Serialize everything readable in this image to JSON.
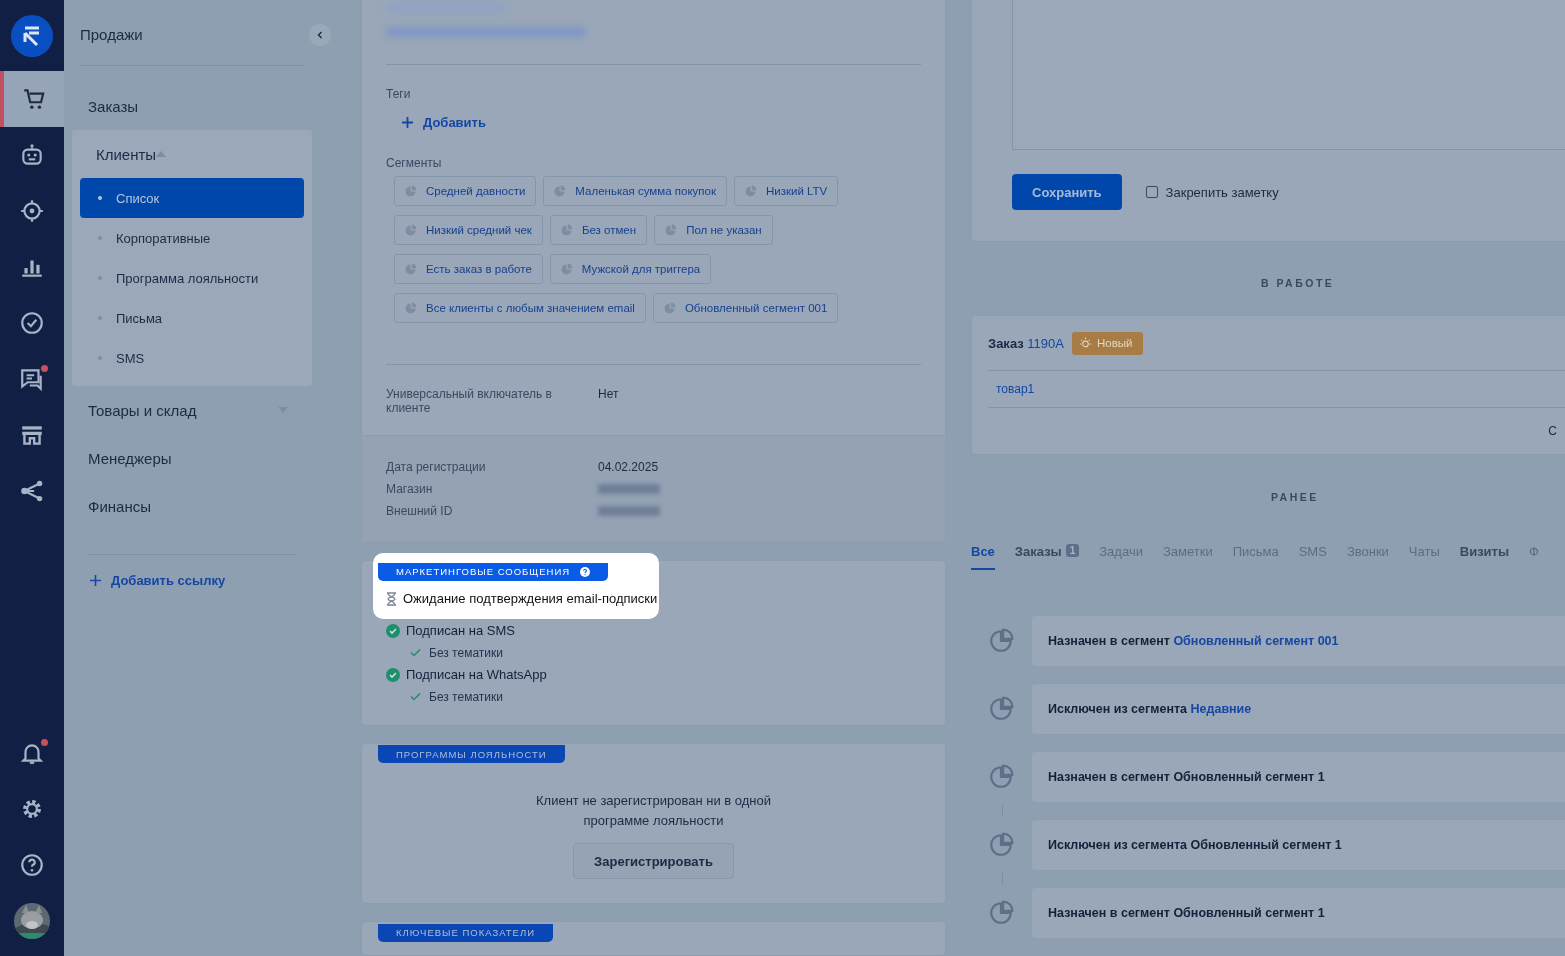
{
  "rail": {
    "items": [
      {
        "kind": "logo",
        "selected": false,
        "dot": false
      },
      {
        "kind": "cart",
        "selected": true,
        "dot": false
      },
      {
        "kind": "robot",
        "selected": false,
        "dot": false
      },
      {
        "kind": "target",
        "selected": false,
        "dot": false
      },
      {
        "kind": "chart",
        "selected": false,
        "dot": false
      },
      {
        "kind": "check",
        "selected": false,
        "dot": false
      },
      {
        "kind": "chat",
        "selected": false,
        "dot": true
      },
      {
        "kind": "store",
        "selected": false,
        "dot": false
      },
      {
        "kind": "share",
        "selected": false,
        "dot": false
      },
      {
        "kind": "bell",
        "selected": false,
        "dot": true
      },
      {
        "kind": "gear",
        "selected": false,
        "dot": false
      },
      {
        "kind": "help",
        "selected": false,
        "dot": false
      },
      {
        "kind": "avatar",
        "selected": false,
        "dot": false
      }
    ]
  },
  "sidebar": {
    "title": "Продажи",
    "items": [
      {
        "label": "Заказы"
      },
      {
        "label": "Клиенты",
        "expanded": true,
        "children": [
          {
            "label": "Список",
            "selected": true
          },
          {
            "label": "Корпоративные",
            "selected": false
          },
          {
            "label": "Программа лояльности",
            "selected": false
          },
          {
            "label": "Письма",
            "selected": false
          },
          {
            "label": "SMS",
            "selected": false
          }
        ]
      },
      {
        "label": "Товары и склад",
        "expanded": false
      },
      {
        "label": "Менеджеры"
      },
      {
        "label": "Финансы"
      }
    ],
    "add_link": "Добавить ссылку"
  },
  "customer": {
    "tags_label": "Теги",
    "add_tag": "Добавить",
    "segments_label": "Сегменты",
    "segments": [
      "Средней давности",
      "Маленькая сумма покупок",
      "Низкий LTV",
      "Низкий средний чек",
      "Без отмен",
      "Пол не указан",
      "Есть заказ в работе",
      "Мужской для триггера",
      "Все клиенты с любым значением email",
      "Обновленный сегмент 001"
    ],
    "universal_label": "Универсальный включатель в клиенте",
    "universal_value": "Нет",
    "fields": [
      {
        "label": "Дата регистрации",
        "value": "04.02.2025",
        "blurred": false
      },
      {
        "label": "Магазин",
        "blurred": true
      },
      {
        "label": "Внешний ID",
        "blurred": true
      }
    ]
  },
  "marketing": {
    "title": "МАРКЕТИНГОВЫЕ СООБЩЕНИЯ",
    "highlighted": true,
    "items": [
      {
        "kind": "pending",
        "text": "Ожидание подтверждения email-подписки",
        "highlighted": true
      },
      {
        "kind": "subscribed",
        "text": "Подписан на SMS",
        "highlighted": false,
        "topics": [
          "Без тематики"
        ]
      },
      {
        "kind": "subscribed",
        "text": "Подписан на WhatsApp",
        "highlighted": false,
        "topics": [
          "Без тематики"
        ]
      }
    ]
  },
  "loyalty": {
    "title": "ПРОГРАММЫ ЛОЯЛЬНОСТИ",
    "message": "Клиент не зарегистрирован ни в одной программе лояльности",
    "button": "Зарегистрировать"
  },
  "indicators": {
    "title": "КЛЮЧЕВЫЕ ПОКАЗАТЕЛИ"
  },
  "note": {
    "save": "Сохранить",
    "pin": {
      "label": "Закрепить заметку",
      "checked": false
    }
  },
  "in_work": {
    "heading": "В РАБОТЕ",
    "order": {
      "label": "Заказ",
      "number": "1190A",
      "status": "Новый",
      "item": "товар1",
      "column_3": "С"
    }
  },
  "earlier": {
    "heading": "РАНЕЕ"
  },
  "tabs": [
    {
      "label": "Все",
      "selected": true,
      "disabled": false
    },
    {
      "label": "Заказы",
      "selected": false,
      "disabled": false,
      "count": "1"
    },
    {
      "label": "Задачи",
      "selected": false,
      "disabled": true
    },
    {
      "label": "Заметки",
      "selected": false,
      "disabled": true
    },
    {
      "label": "Письма",
      "selected": false,
      "disabled": true
    },
    {
      "label": "SMS",
      "selected": false,
      "disabled": true
    },
    {
      "label": "Звонки",
      "selected": false,
      "disabled": true
    },
    {
      "label": "Чаты",
      "selected": false,
      "disabled": true
    },
    {
      "label": "Визиты",
      "selected": false,
      "disabled": false
    },
    {
      "label": "Ф",
      "selected": false,
      "disabled": true
    }
  ],
  "events": [
    {
      "text": "Назначен в сегмент",
      "target": "Обновленный сегмент 001",
      "linked": true,
      "connector": false
    },
    {
      "text": "Исключен из сегмента",
      "target": "Недавние",
      "linked": true,
      "connector": false
    },
    {
      "text": "Назначен в сегмент",
      "target": "Обновленный сегмент 1",
      "linked": false,
      "connector": false
    },
    {
      "text": "Исключен из сегмента",
      "target": "Обновленный сегмент 1",
      "linked": false,
      "connector": true
    },
    {
      "text": "Назначен в сегмент",
      "target": "Обновленный сегмент 1",
      "linked": false,
      "connector": true
    }
  ]
}
